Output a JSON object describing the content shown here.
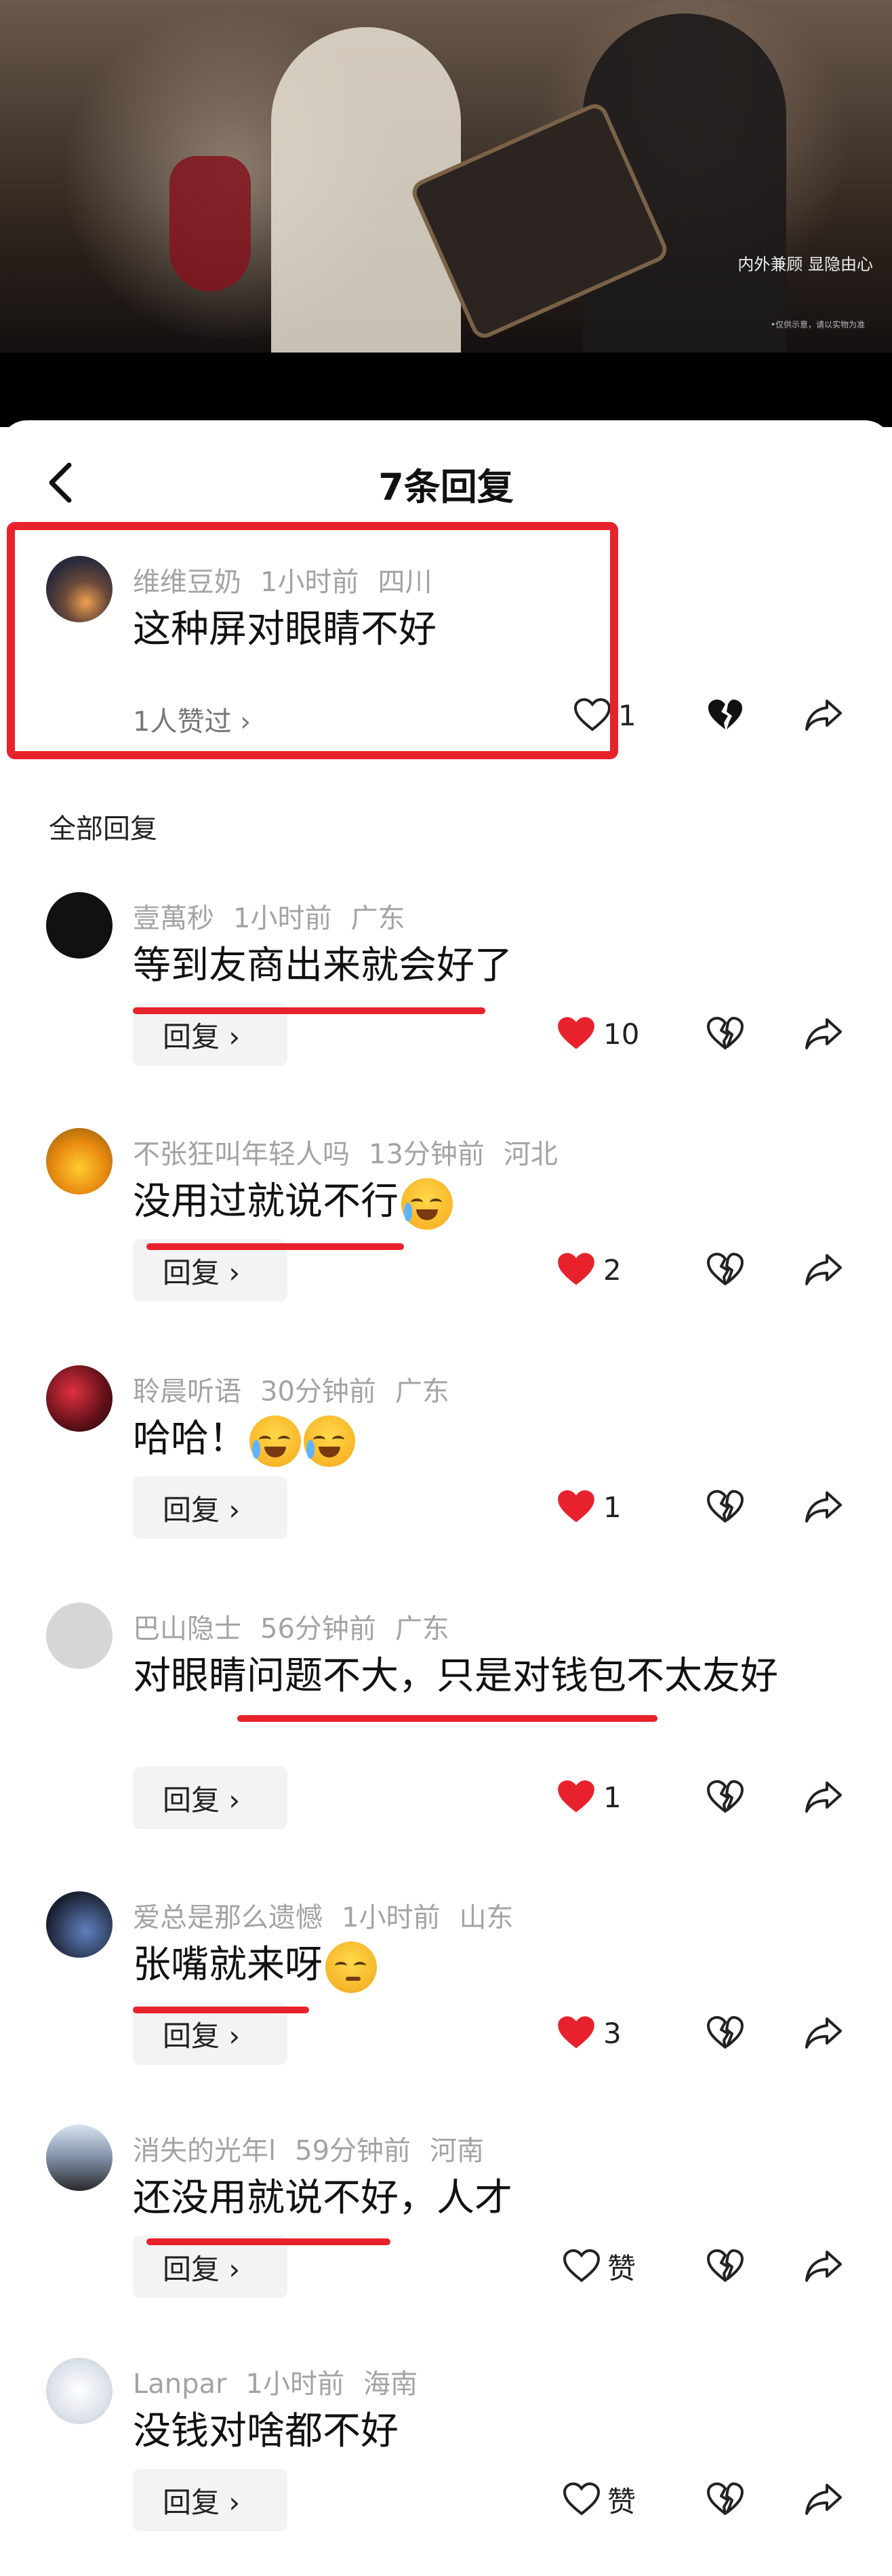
{
  "video": {
    "caption": "内外兼顾 显隐由心",
    "fineprint": "•仅供示意，请以实物为准"
  },
  "header": {
    "title": "7条回复",
    "back_icon": "chevron-left-icon"
  },
  "section_title": "全部回复",
  "reply_label": "回复 ›",
  "colors": {
    "accent_red": "#e8222c",
    "like_red": "#e8222c",
    "meta_gray": "#a3a3a3"
  },
  "original": {
    "username": "维维豆奶",
    "time": "1小时前",
    "location": "四川",
    "text": "这种屏对眼睛不好",
    "likes_link": "1人赞过 ›",
    "like_count": "1",
    "liked": false
  },
  "replies": [
    {
      "username": "壹萬秒",
      "time": "1小时前",
      "location": "广东",
      "text": "等到友商出来就会好了",
      "like_count": "10",
      "liked": true
    },
    {
      "username": "不张狂叫年轻人吗",
      "time": "13分钟前",
      "location": "河北",
      "text": "没用过就说不行",
      "emoji": "crying-laughing-emoji",
      "like_count": "2",
      "liked": true
    },
    {
      "username": "聆晨听语",
      "time": "30分钟前",
      "location": "广东",
      "text": "哈哈！",
      "emoji": "crying-laughing-emoji",
      "like_count": "1",
      "liked": true
    },
    {
      "username": "巴山隐士",
      "time": "56分钟前",
      "location": "广东",
      "text": "对眼睛问题不大，只是对钱包不太友好",
      "like_count": "1",
      "liked": true
    },
    {
      "username": "爱总是那么遗憾",
      "time": "1小时前",
      "location": "山东",
      "text": "张嘴就来呀",
      "emoji": "thinking-emoji",
      "like_count": "3",
      "liked": true
    },
    {
      "username": "消失的光年l",
      "time": "59分钟前",
      "location": "河南",
      "text": "还没用就说不好，人才",
      "like_count": "赞",
      "liked": false
    },
    {
      "username": "Lanpar",
      "time": "1小时前",
      "location": "海南",
      "text": "没钱对啥都不好",
      "like_count": "赞",
      "liked": false
    }
  ]
}
